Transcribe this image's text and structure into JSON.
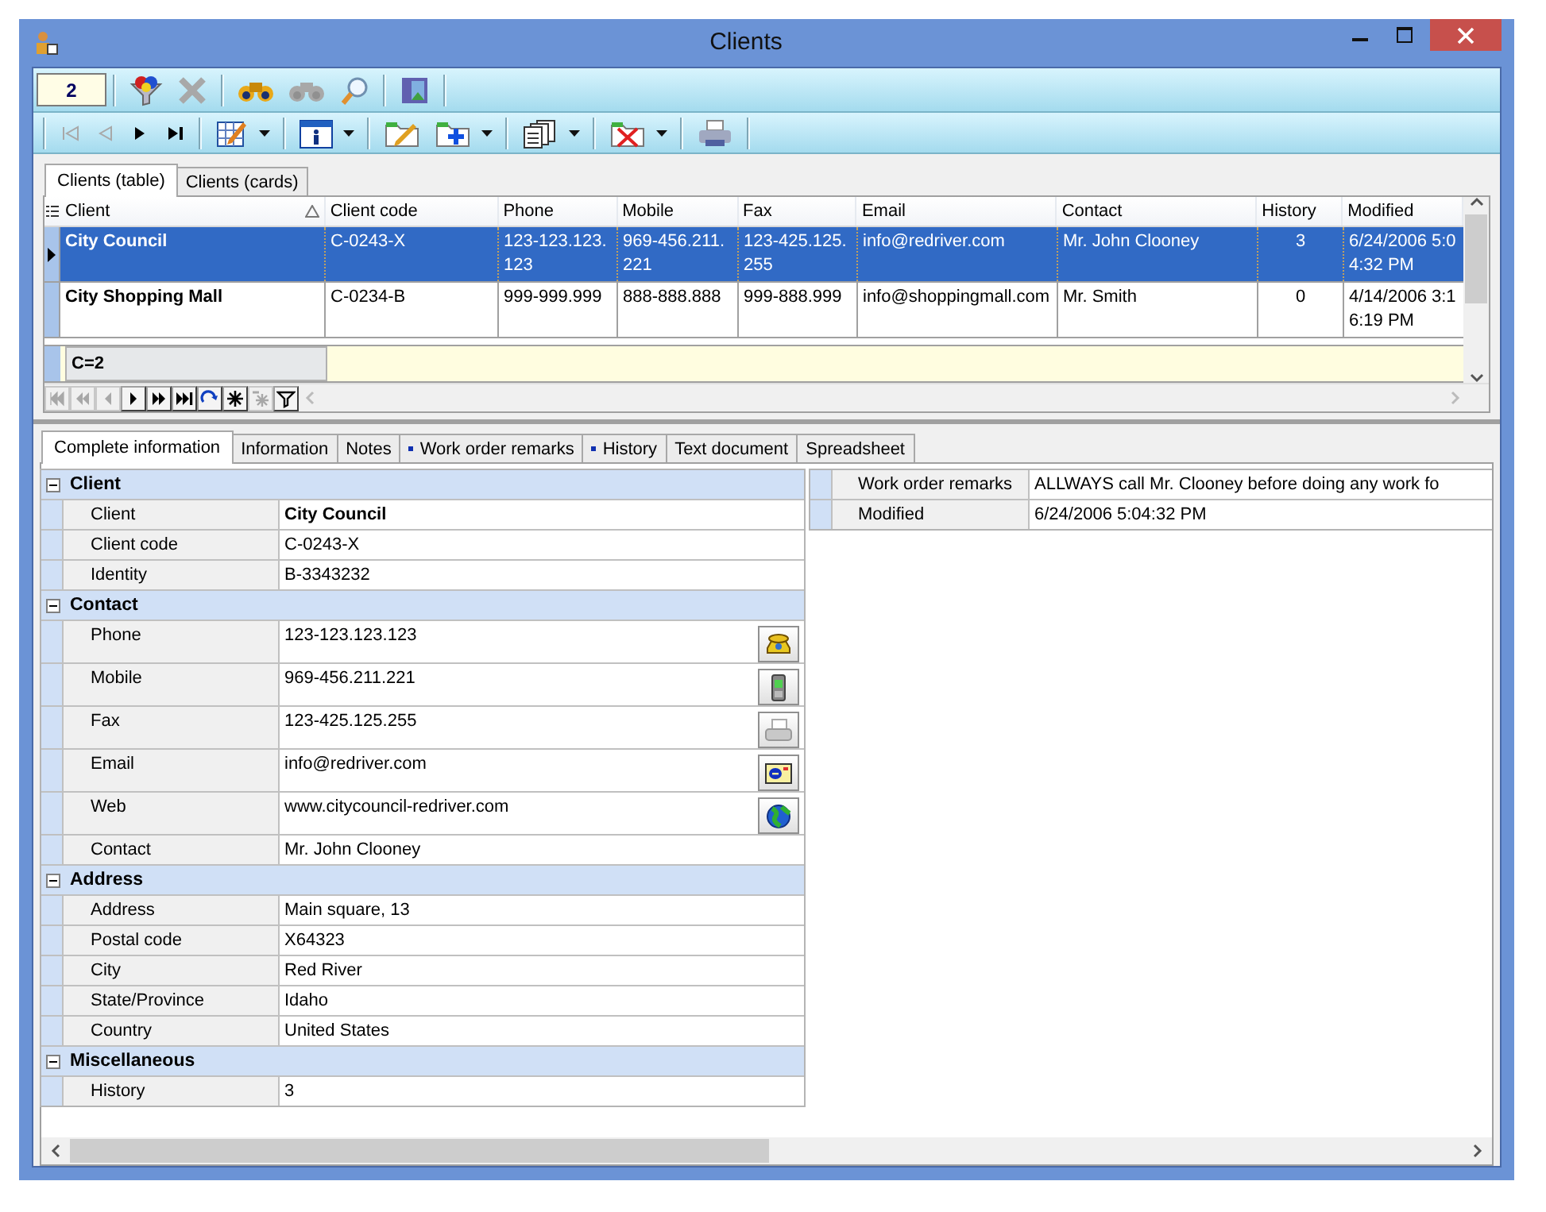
{
  "window": {
    "title": "Clients"
  },
  "toolbar_1": {
    "record": "2",
    "groups": [
      [
        {
          "kind": "funnel",
          "disabled": false
        },
        {
          "kind": "delete",
          "disabled": true
        }
      ],
      [
        {
          "kind": "binoculars",
          "disabled": false
        },
        {
          "kind": "binoculars",
          "disabled": true
        },
        {
          "kind": "magnifier",
          "disabled": false
        }
      ],
      [
        {
          "kind": "exit",
          "disabled": false
        }
      ]
    ]
  },
  "toolbar_2": {
    "groups": [
      [
        {
          "kind": "first",
          "disabled": true,
          "dropdown": false
        },
        {
          "kind": "prev",
          "disabled": true,
          "dropdown": false
        },
        {
          "kind": "next",
          "disabled": false,
          "dropdown": false
        },
        {
          "kind": "last",
          "disabled": false,
          "dropdown": false
        }
      ],
      [
        {
          "kind": "grid-edit",
          "disabled": false,
          "dropdown": true
        }
      ],
      [
        {
          "kind": "info",
          "disabled": false,
          "dropdown": true
        }
      ],
      [
        {
          "kind": "edit",
          "disabled": false,
          "dropdown": false
        },
        {
          "kind": "add",
          "disabled": false,
          "dropdown": true
        }
      ],
      [
        {
          "kind": "copy",
          "disabled": false,
          "dropdown": true
        }
      ],
      [
        {
          "kind": "remove",
          "disabled": false,
          "dropdown": true
        }
      ],
      [
        {
          "kind": "print",
          "disabled": false,
          "dropdown": false
        }
      ]
    ]
  },
  "clients_tabs": [
    {
      "label": "Clients (table)",
      "selected": true
    },
    {
      "label": "Clients (cards)",
      "selected": false
    }
  ],
  "table": {
    "columns": [
      {
        "label": "Client",
        "sorted": true
      },
      {
        "label": "Client code",
        "sorted": false
      },
      {
        "label": "Phone",
        "sorted": false
      },
      {
        "label": "Mobile",
        "sorted": false
      },
      {
        "label": "Fax",
        "sorted": false
      },
      {
        "label": "Email",
        "sorted": false
      },
      {
        "label": "Contact",
        "sorted": false
      },
      {
        "label": "History",
        "sorted": false
      },
      {
        "label": "Modified",
        "sorted": false
      }
    ],
    "rows": [
      {
        "selected": true,
        "cells": [
          "City Council",
          "C-0243-X",
          "123-123.123.123",
          "969-456.211.221",
          "123-425.125.255",
          "info@redriver.com",
          "Mr. John Clooney",
          "3",
          "6/24/2006 5:04:32 PM"
        ]
      },
      {
        "selected": false,
        "cells": [
          "City Shopping Mall",
          "C-0234-B",
          "999-999.999",
          "888-888.888",
          "999-888.999",
          "info@shoppingmall.com",
          "Mr. Smith",
          "0",
          "4/14/2006 3:16:19 PM"
        ]
      }
    ],
    "footer": "C=2"
  },
  "navigator": [
    {
      "kind": "first",
      "disabled": true
    },
    {
      "kind": "prior-page",
      "disabled": true
    },
    {
      "kind": "prior",
      "disabled": true
    },
    {
      "kind": "next",
      "disabled": false
    },
    {
      "kind": "next-page",
      "disabled": false
    },
    {
      "kind": "last",
      "disabled": false
    },
    {
      "kind": "refresh",
      "disabled": false
    },
    {
      "kind": "insert",
      "disabled": false
    },
    {
      "kind": "delete",
      "disabled": true
    },
    {
      "kind": "filter",
      "disabled": false
    }
  ],
  "detail_tabs": [
    {
      "label": "Complete information",
      "selected": true,
      "marked": false
    },
    {
      "label": "Information",
      "selected": false,
      "marked": false
    },
    {
      "label": "Notes",
      "selected": false,
      "marked": false
    },
    {
      "label": "Work order remarks",
      "selected": false,
      "marked": true
    },
    {
      "label": "History",
      "selected": false,
      "marked": true
    },
    {
      "label": "Text document",
      "selected": false,
      "marked": false
    },
    {
      "label": "Spreadsheet",
      "selected": false,
      "marked": false
    }
  ],
  "property_grid": [
    {
      "title": "Client",
      "expanded": true,
      "rows": [
        {
          "kind": "plain",
          "label": "Client",
          "value": "City Council",
          "bold": true
        },
        {
          "kind": "plain",
          "label": "Client code",
          "value": "C-0243-X",
          "bold": false
        },
        {
          "kind": "plain",
          "label": "Identity",
          "value": "B-3343232",
          "bold": false
        }
      ]
    },
    {
      "title": "Contact",
      "expanded": true,
      "rows": [
        {
          "kind": "phone",
          "label": "Phone",
          "value": "123-123.123.123",
          "bold": false
        },
        {
          "kind": "mobile",
          "label": "Mobile",
          "value": "969-456.211.221",
          "bold": false
        },
        {
          "kind": "fax",
          "label": "Fax",
          "value": "123-425.125.255",
          "bold": false
        },
        {
          "kind": "email",
          "label": "Email",
          "value": "info@redriver.com",
          "bold": false
        },
        {
          "kind": "web",
          "label": "Web",
          "value": "www.citycouncil-redriver.com",
          "bold": false
        },
        {
          "kind": "plain",
          "label": "Contact",
          "value": "Mr. John Clooney",
          "bold": false
        }
      ]
    },
    {
      "title": "Address",
      "expanded": true,
      "rows": [
        {
          "kind": "plain",
          "label": "Address",
          "value": "Main square, 13",
          "bold": false
        },
        {
          "kind": "plain",
          "label": "Postal code",
          "value": "X64323",
          "bold": false
        },
        {
          "kind": "plain",
          "label": "City",
          "value": "Red River",
          "bold": false
        },
        {
          "kind": "plain",
          "label": "State/Province",
          "value": "Idaho",
          "bold": false
        },
        {
          "kind": "plain",
          "label": "Country",
          "value": "United States",
          "bold": false
        }
      ]
    },
    {
      "title": "Miscellaneous",
      "expanded": true,
      "rows": [
        {
          "kind": "plain",
          "label": "History",
          "value": "3",
          "bold": false
        }
      ]
    }
  ],
  "side_grid": [
    {
      "label": "Work order remarks",
      "value": "ALLWAYS call Mr. Clooney before doing any work fo"
    },
    {
      "label": "Modified",
      "value": "6/24/2006 5:04:32 PM"
    }
  ]
}
